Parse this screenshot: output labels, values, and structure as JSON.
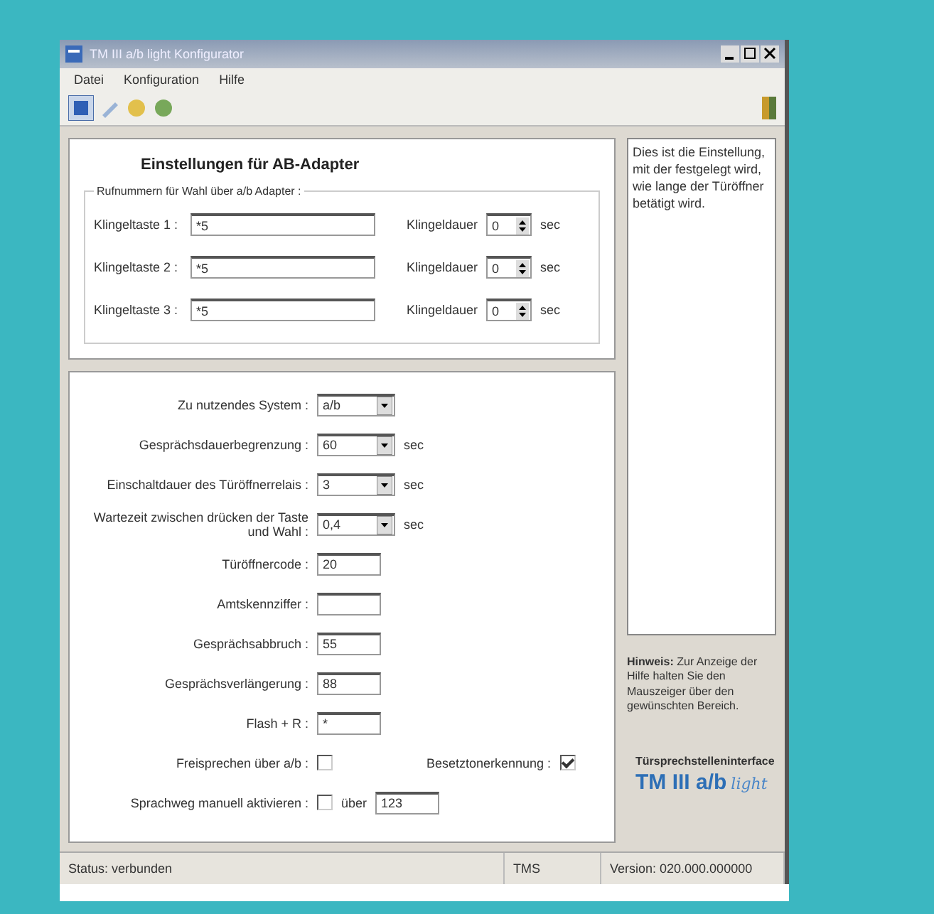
{
  "window": {
    "title": "TM III a/b light Konfigurator"
  },
  "menu": [
    "Datei",
    "Konfiguration",
    "Hilfe"
  ],
  "heading": "Einstellungen für AB-Adapter",
  "group_title": "Rufnummern für Wahl über a/b Adapter :",
  "bell_buttons": [
    {
      "label": "Klingeltaste 1 :",
      "value": "*5",
      "duration_label": "Klingeldauer",
      "duration_value": "0",
      "unit": "sec"
    },
    {
      "label": "Klingeltaste 2 :",
      "value": "*5",
      "duration_label": "Klingeldauer",
      "duration_value": "0",
      "unit": "sec"
    },
    {
      "label": "Klingeltaste 3 :",
      "value": "*5",
      "duration_label": "Klingeldauer",
      "duration_value": "0",
      "unit": "sec"
    }
  ],
  "settings": [
    {
      "kind": "select",
      "label": "Zu nutzendes System :",
      "value": "a/b"
    },
    {
      "kind": "select",
      "label": "Gesprächsdauerbegrenzung :",
      "value": "60",
      "unit": "sec"
    },
    {
      "kind": "select",
      "label": "Einschaltdauer des Türöffnerrelais :",
      "value": "3",
      "unit": "sec"
    },
    {
      "kind": "select",
      "label": "Wartezeit zwischen drücken der Taste und Wahl :",
      "value": "0,4",
      "unit": "sec"
    },
    {
      "kind": "text",
      "label": "Türöffnercode :",
      "value": "20"
    },
    {
      "kind": "text",
      "label": "Amtskennziffer :"
    },
    {
      "kind": "text",
      "label": "Gesprächsabbruch :",
      "value": "55"
    },
    {
      "kind": "text",
      "label": "Gesprächsverlängerung :",
      "value": "88"
    },
    {
      "kind": "text",
      "label": "Flash + R :",
      "value": "*"
    },
    {
      "kind": "checkboxes",
      "items": [
        {
          "label": "Freisprechen über a/b :",
          "checked": false
        },
        {
          "label": "Besetztonerkennung :",
          "checked": true
        }
      ]
    },
    {
      "kind": "check_field",
      "label": "Sprachweg manuell aktivieren :",
      "checked": false,
      "field_label": "über",
      "value": "123"
    }
  ],
  "help_text": "Dies ist die Einstellung, mit der festgelegt wird, wie lange der Türöffner betätigt wird.",
  "hint": "**Hinweis:** Zur Anzeige der Hilfe halten Sie den Mauszeiger über den gewünschten Bereich.",
  "logo": {
    "caption": "Türsprechstelleninterface",
    "name": "TM III a/b",
    "suffix": "light"
  },
  "status_bar": [
    "Status: verbunden",
    "TMS",
    "Version: 020.000.000000"
  ]
}
